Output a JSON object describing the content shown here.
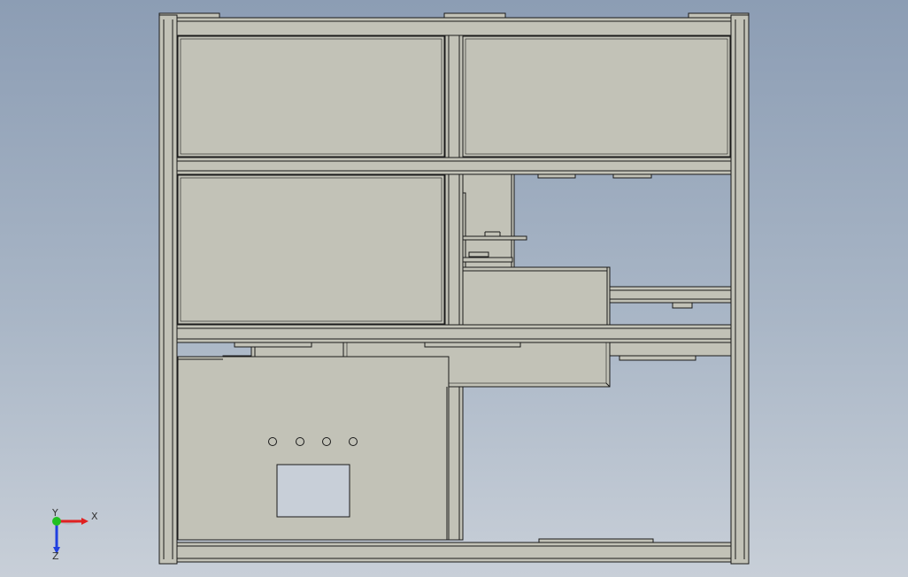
{
  "viewport": {
    "model_fill": "#c2c2b7",
    "edge_color": "#1a1a1a",
    "background_top": "#8c9db4",
    "background_bottom": "#c8cfd8"
  },
  "control_panel": {
    "indicator_holes": 4,
    "display_window": true
  },
  "triad": {
    "x_label": "X",
    "y_label": "Y",
    "z_label": "Z",
    "x_color": "#e02020",
    "y_color": "#20c020",
    "z_color": "#2040e0"
  }
}
